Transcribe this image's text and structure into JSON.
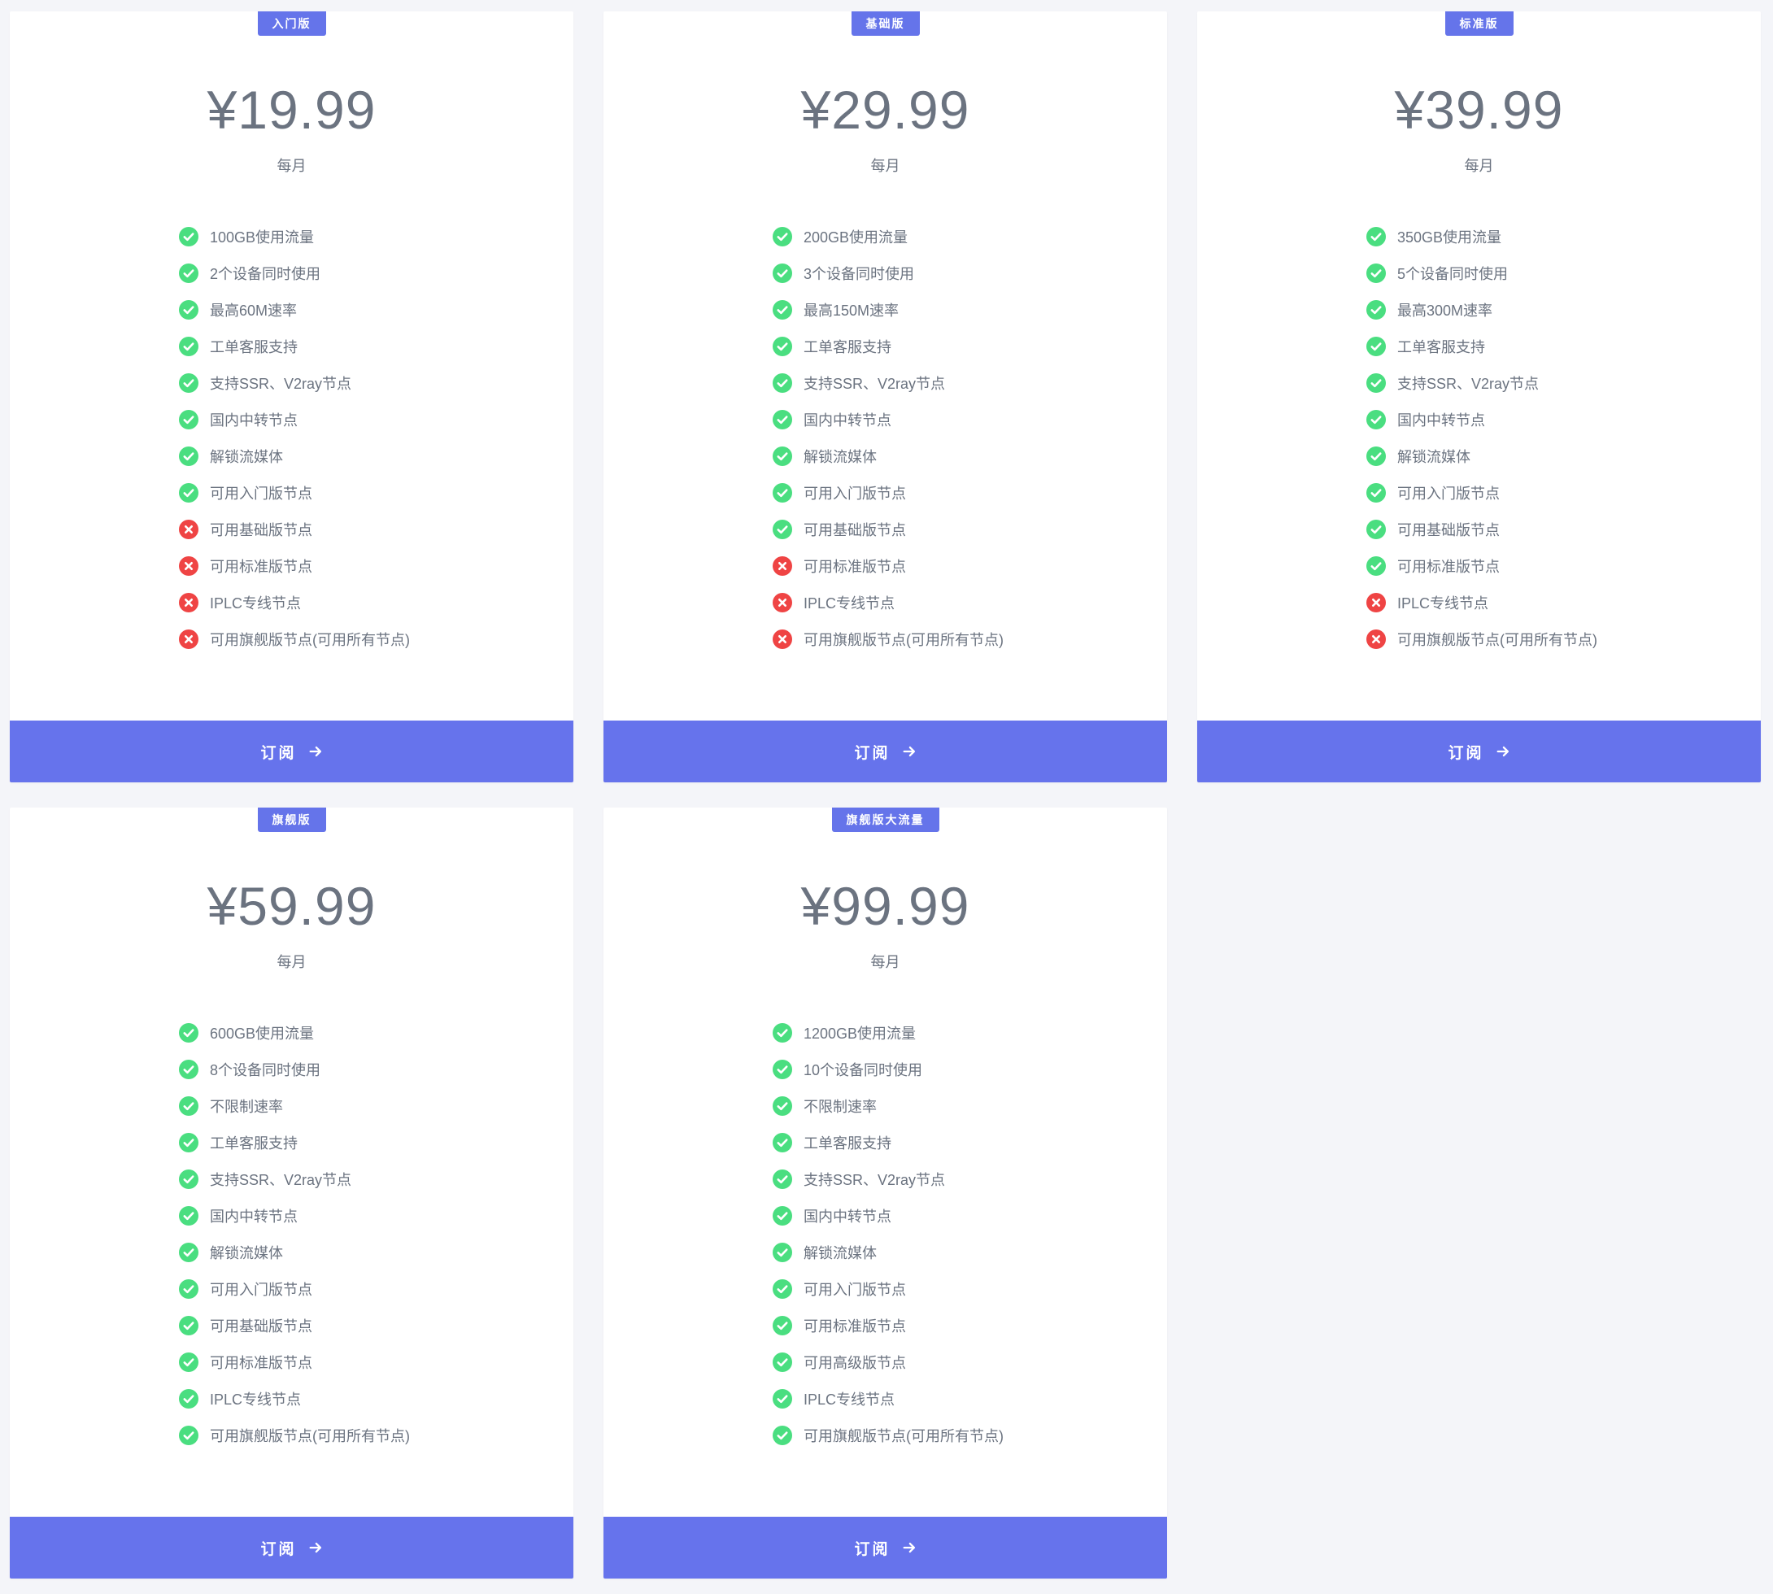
{
  "colors": {
    "accent": "#6673ec",
    "background": "#f4f5f9",
    "text": "#6b7380",
    "check": "#4ade80",
    "cross": "#ef4444"
  },
  "plans": [
    {
      "badge": "入门版",
      "price": "¥19.99",
      "period": "每月",
      "button_label": "订阅",
      "features": [
        {
          "text": "100GB使用流量",
          "included": true,
          "icon": "check-circle-icon"
        },
        {
          "text": "2个设备同时使用",
          "included": true,
          "icon": "check-circle-icon"
        },
        {
          "text": "最高60M速率",
          "included": true,
          "icon": "check-circle-icon"
        },
        {
          "text": "工单客服支持",
          "included": true,
          "icon": "check-circle-icon"
        },
        {
          "text": "支持SSR、V2ray节点",
          "included": true,
          "icon": "check-circle-icon"
        },
        {
          "text": "国内中转节点",
          "included": true,
          "icon": "check-circle-icon"
        },
        {
          "text": "解锁流媒体",
          "included": true,
          "icon": "check-circle-icon"
        },
        {
          "text": "可用入门版节点",
          "included": true,
          "icon": "check-circle-icon"
        },
        {
          "text": "可用基础版节点",
          "included": false,
          "icon": "cross-circle-icon"
        },
        {
          "text": "可用标准版节点",
          "included": false,
          "icon": "cross-circle-icon"
        },
        {
          "text": "IPLC专线节点",
          "included": false,
          "icon": "cross-circle-icon"
        },
        {
          "text": "可用旗舰版节点(可用所有节点)",
          "included": false,
          "icon": "cross-circle-icon"
        }
      ]
    },
    {
      "badge": "基础版",
      "price": "¥29.99",
      "period": "每月",
      "button_label": "订阅",
      "features": [
        {
          "text": "200GB使用流量",
          "included": true,
          "icon": "check-circle-icon"
        },
        {
          "text": "3个设备同时使用",
          "included": true,
          "icon": "check-circle-icon"
        },
        {
          "text": "最高150M速率",
          "included": true,
          "icon": "check-circle-icon"
        },
        {
          "text": "工单客服支持",
          "included": true,
          "icon": "check-circle-icon"
        },
        {
          "text": "支持SSR、V2ray节点",
          "included": true,
          "icon": "check-circle-icon"
        },
        {
          "text": "国内中转节点",
          "included": true,
          "icon": "check-circle-icon"
        },
        {
          "text": "解锁流媒体",
          "included": true,
          "icon": "check-circle-icon"
        },
        {
          "text": "可用入门版节点",
          "included": true,
          "icon": "check-circle-icon"
        },
        {
          "text": "可用基础版节点",
          "included": true,
          "icon": "check-circle-icon"
        },
        {
          "text": "可用标准版节点",
          "included": false,
          "icon": "cross-circle-icon"
        },
        {
          "text": "IPLC专线节点",
          "included": false,
          "icon": "cross-circle-icon"
        },
        {
          "text": "可用旗舰版节点(可用所有节点)",
          "included": false,
          "icon": "cross-circle-icon"
        }
      ]
    },
    {
      "badge": "标准版",
      "price": "¥39.99",
      "period": "每月",
      "button_label": "订阅",
      "features": [
        {
          "text": "350GB使用流量",
          "included": true,
          "icon": "check-circle-icon"
        },
        {
          "text": "5个设备同时使用",
          "included": true,
          "icon": "check-circle-icon"
        },
        {
          "text": "最高300M速率",
          "included": true,
          "icon": "check-circle-icon"
        },
        {
          "text": "工单客服支持",
          "included": true,
          "icon": "check-circle-icon"
        },
        {
          "text": "支持SSR、V2ray节点",
          "included": true,
          "icon": "check-circle-icon"
        },
        {
          "text": "国内中转节点",
          "included": true,
          "icon": "check-circle-icon"
        },
        {
          "text": "解锁流媒体",
          "included": true,
          "icon": "check-circle-icon"
        },
        {
          "text": "可用入门版节点",
          "included": true,
          "icon": "check-circle-icon"
        },
        {
          "text": "可用基础版节点",
          "included": true,
          "icon": "check-circle-icon"
        },
        {
          "text": "可用标准版节点",
          "included": true,
          "icon": "check-circle-icon"
        },
        {
          "text": "IPLC专线节点",
          "included": false,
          "icon": "cross-circle-icon"
        },
        {
          "text": "可用旗舰版节点(可用所有节点)",
          "included": false,
          "icon": "cross-circle-icon"
        }
      ]
    },
    {
      "badge": "旗舰版",
      "price": "¥59.99",
      "period": "每月",
      "button_label": "订阅",
      "features": [
        {
          "text": "600GB使用流量",
          "included": true,
          "icon": "check-circle-icon"
        },
        {
          "text": "8个设备同时使用",
          "included": true,
          "icon": "check-circle-icon"
        },
        {
          "text": "不限制速率",
          "included": true,
          "icon": "check-circle-icon"
        },
        {
          "text": "工单客服支持",
          "included": true,
          "icon": "check-circle-icon"
        },
        {
          "text": "支持SSR、V2ray节点",
          "included": true,
          "icon": "check-circle-icon"
        },
        {
          "text": "国内中转节点",
          "included": true,
          "icon": "check-circle-icon"
        },
        {
          "text": "解锁流媒体",
          "included": true,
          "icon": "check-circle-icon"
        },
        {
          "text": "可用入门版节点",
          "included": true,
          "icon": "check-circle-icon"
        },
        {
          "text": "可用基础版节点",
          "included": true,
          "icon": "check-circle-icon"
        },
        {
          "text": "可用标准版节点",
          "included": true,
          "icon": "check-circle-icon"
        },
        {
          "text": "IPLC专线节点",
          "included": true,
          "icon": "check-circle-icon"
        },
        {
          "text": "可用旗舰版节点(可用所有节点)",
          "included": true,
          "icon": "check-circle-icon"
        }
      ]
    },
    {
      "badge": "旗舰版大流量",
      "price": "¥99.99",
      "period": "每月",
      "button_label": "订阅",
      "features": [
        {
          "text": "1200GB使用流量",
          "included": true,
          "icon": "check-circle-icon"
        },
        {
          "text": "10个设备同时使用",
          "included": true,
          "icon": "check-circle-icon"
        },
        {
          "text": "不限制速率",
          "included": true,
          "icon": "check-circle-icon"
        },
        {
          "text": "工单客服支持",
          "included": true,
          "icon": "check-circle-icon"
        },
        {
          "text": "支持SSR、V2ray节点",
          "included": true,
          "icon": "check-circle-icon"
        },
        {
          "text": "国内中转节点",
          "included": true,
          "icon": "check-circle-icon"
        },
        {
          "text": "解锁流媒体",
          "included": true,
          "icon": "check-circle-icon"
        },
        {
          "text": "可用入门版节点",
          "included": true,
          "icon": "check-circle-icon"
        },
        {
          "text": "可用标准版节点",
          "included": true,
          "icon": "check-circle-icon"
        },
        {
          "text": "可用高级版节点",
          "included": true,
          "icon": "check-circle-icon"
        },
        {
          "text": "IPLC专线节点",
          "included": true,
          "icon": "check-circle-icon"
        },
        {
          "text": "可用旗舰版节点(可用所有节点)",
          "included": true,
          "icon": "check-circle-icon"
        }
      ]
    }
  ]
}
